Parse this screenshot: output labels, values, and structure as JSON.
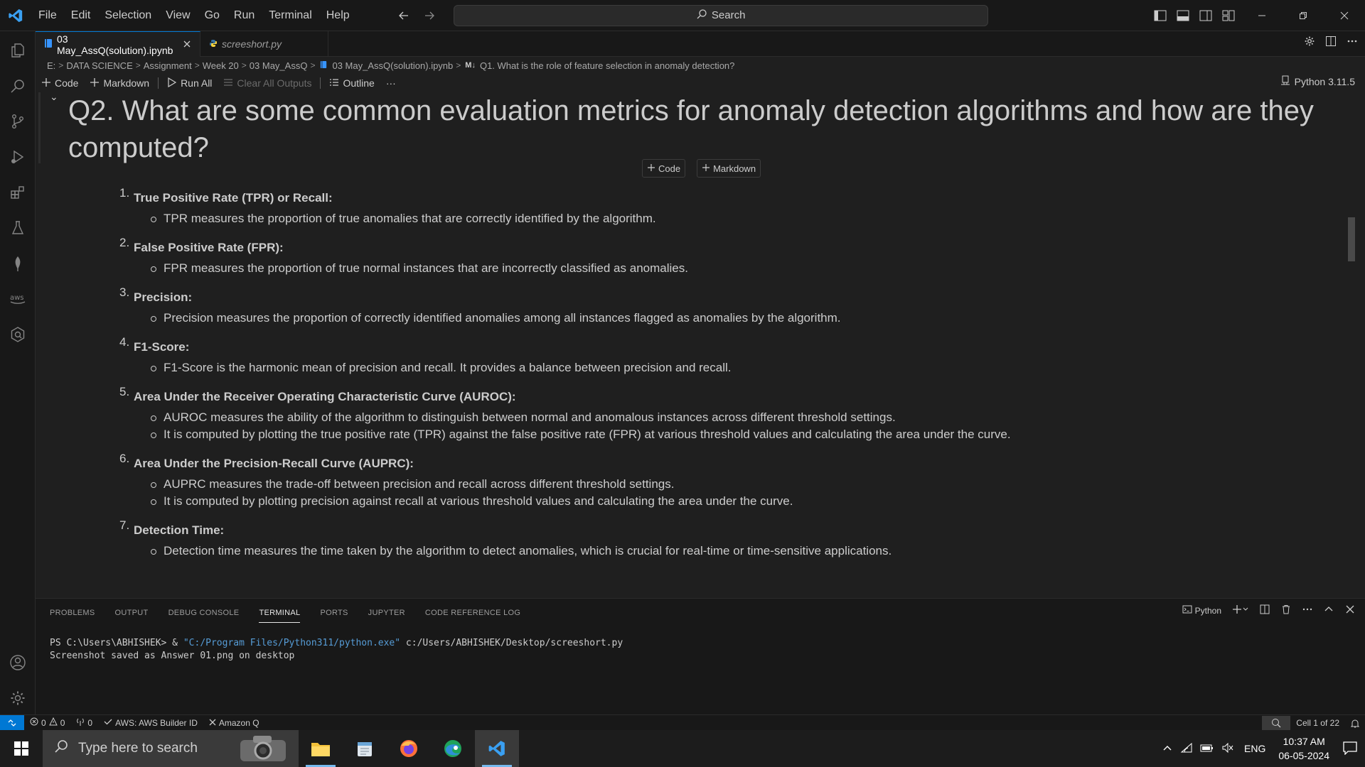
{
  "titlebar": {
    "menu": [
      "File",
      "Edit",
      "Selection",
      "View",
      "Go",
      "Run",
      "Terminal",
      "Help"
    ],
    "search_label": "Search"
  },
  "tabs": [
    {
      "label": "03 May_AssQ(solution).ipynb",
      "active": true
    },
    {
      "label": "screeshort.py",
      "active": false
    }
  ],
  "breadcrumb": [
    "E:",
    "DATA SCIENCE",
    "Assignment",
    "Week 20",
    "03 May_AssQ",
    "03 May_AssQ(solution).ipynb",
    "Q1. What is the role of feature selection in anomaly detection?"
  ],
  "breadcrumb_md_badge": "M↓",
  "toolbar": {
    "code": "Code",
    "markdown": "Markdown",
    "run_all": "Run All",
    "clear_outputs": "Clear All Outputs",
    "outline": "Outline",
    "more": "···",
    "kernel": "Python 3.11.5"
  },
  "cell": {
    "heading": "Q2. What are some common evaluation metrics for anomaly detection algorithms and how are they computed?",
    "insert_code": "Code",
    "insert_markdown": "Markdown",
    "items": [
      {
        "num": "1.",
        "title": "True Positive Rate (TPR) or Recall:",
        "bullets": [
          "TPR measures the proportion of true anomalies that are correctly identified by the algorithm."
        ]
      },
      {
        "num": "2.",
        "title": "False Positive Rate (FPR):",
        "bullets": [
          "FPR measures the proportion of true normal instances that are incorrectly classified as anomalies."
        ]
      },
      {
        "num": "3.",
        "title": "Precision:",
        "bullets": [
          "Precision measures the proportion of correctly identified anomalies among all instances flagged as anomalies by the algorithm."
        ]
      },
      {
        "num": "4.",
        "title": "F1-Score:",
        "bullets": [
          "F1-Score is the harmonic mean of precision and recall. It provides a balance between precision and recall."
        ]
      },
      {
        "num": "5.",
        "title": "Area Under the Receiver Operating Characteristic Curve (AUROC):",
        "bullets": [
          "AUROC measures the ability of the algorithm to distinguish between normal and anomalous instances across different threshold settings.",
          "It is computed by plotting the true positive rate (TPR) against the false positive rate (FPR) at various threshold values and calculating the area under the curve."
        ]
      },
      {
        "num": "6.",
        "title": "Area Under the Precision-Recall Curve (AUPRC):",
        "bullets": [
          "AUPRC measures the trade-off between precision and recall across different threshold settings.",
          "It is computed by plotting precision against recall at various threshold values and calculating the area under the curve."
        ]
      },
      {
        "num": "7.",
        "title": "Detection Time:",
        "bullets": [
          "Detection time measures the time taken by the algorithm to detect anomalies, which is crucial for real-time or time-sensitive applications."
        ]
      }
    ]
  },
  "panel": {
    "tabs": [
      "PROBLEMS",
      "OUTPUT",
      "DEBUG CONSOLE",
      "TERMINAL",
      "PORTS",
      "JUPYTER",
      "CODE REFERENCE LOG"
    ],
    "active_tab": "TERMINAL",
    "shell_label": "Python",
    "terminal_prompt": "PS C:\\Users\\ABHISHEK> & ",
    "terminal_exe": "\"C:/Program Files/Python311/python.exe\"",
    "terminal_arg": " c:/Users/ABHISHEK/Desktop/screeshort.py",
    "terminal_output": "Screenshot saved as Answer 01.png on desktop"
  },
  "statusbar": {
    "errors": "0",
    "warnings": "0",
    "ports": "0",
    "aws": "AWS: AWS Builder ID",
    "amazonq": "Amazon Q",
    "cell_pos": "Cell 1 of 22"
  },
  "taskbar": {
    "search_placeholder": "Type here to search",
    "lang": "ENG",
    "time": "10:37 AM",
    "date": "06-05-2024"
  },
  "colors": {
    "accent": "#0078d4",
    "editor_bg": "#1f1f1f",
    "chrome_bg": "#181818"
  }
}
